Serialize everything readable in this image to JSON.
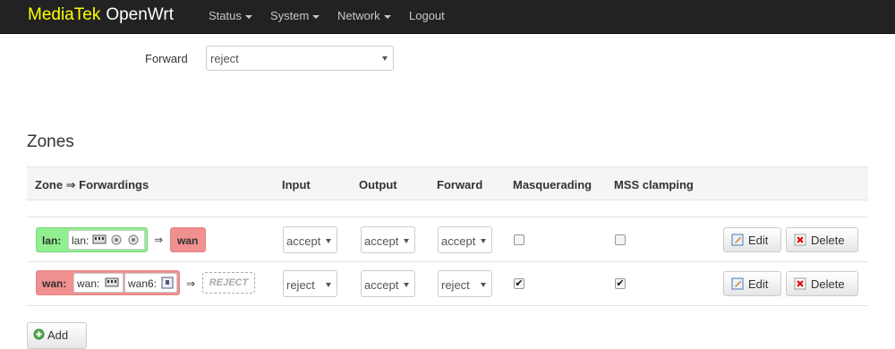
{
  "brand": {
    "vendor": "MediaTek",
    "product": "OpenWrt"
  },
  "nav": {
    "status": "Status",
    "system": "System",
    "network": "Network",
    "logout": "Logout"
  },
  "defaults": {
    "forward_label": "Forward",
    "forward_value": "reject"
  },
  "zones": {
    "title": "Zones",
    "headers": {
      "zone": "Zone ⇒ Forwardings",
      "input": "Input",
      "output": "Output",
      "forward": "Forward",
      "masq": "Masquerading",
      "mss": "MSS clamping"
    },
    "rows": [
      {
        "zone": "lan:",
        "networks": [
          "lan:"
        ],
        "arrow": "⇒",
        "target": "wan",
        "input": "accept",
        "output": "accept",
        "forward": "accept",
        "masq": false,
        "mss": false
      },
      {
        "zone": "wan:",
        "networks": [
          "wan:",
          "wan6:"
        ],
        "arrow": "⇒",
        "target": "REJECT",
        "input": "reject",
        "output": "accept",
        "forward": "reject",
        "masq": true,
        "mss": true
      }
    ],
    "edit_label": "Edit",
    "delete_label": "Delete",
    "add_label": "Add",
    "check_mark": "✔"
  },
  "colors": {
    "lan_zone": "#90f090",
    "wan_zone": "#f09090",
    "navbar": "#222222",
    "brand_vendor": "#ffff00"
  }
}
